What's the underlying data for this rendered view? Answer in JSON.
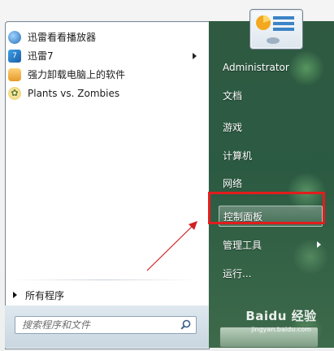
{
  "recent_programs": [
    {
      "label": "迅雷看看播放器",
      "icon": "xunlei-player-icon",
      "has_submenu": false
    },
    {
      "label": "迅雷7",
      "icon": "xunlei-icon",
      "has_submenu": true
    },
    {
      "label": "强力卸载电脑上的软件",
      "icon": "uninstall-icon",
      "has_submenu": false
    },
    {
      "label": "Plants vs. Zombies",
      "icon": "plants-vs-zombies-icon",
      "has_submenu": false
    }
  ],
  "all_programs_label": "所有程序",
  "search": {
    "placeholder": "搜索程序和文件"
  },
  "user": {
    "name": "Administrator"
  },
  "right_menu": [
    {
      "label": "文档",
      "has_submenu": false
    },
    {
      "label": "游戏",
      "has_submenu": false
    },
    {
      "label": "计算机",
      "has_submenu": false
    },
    {
      "label": "网络",
      "has_submenu": false
    },
    {
      "label": "控制面板",
      "has_submenu": false,
      "highlighted": true
    },
    {
      "label": "管理工具",
      "has_submenu": true
    },
    {
      "label": "运行...",
      "has_submenu": false
    }
  ],
  "watermark": {
    "logo": "Baidu 经验",
    "url": "jingyan.baidu.com"
  },
  "colors": {
    "annotation": "#e21d1d",
    "arrow": "#d02020"
  }
}
